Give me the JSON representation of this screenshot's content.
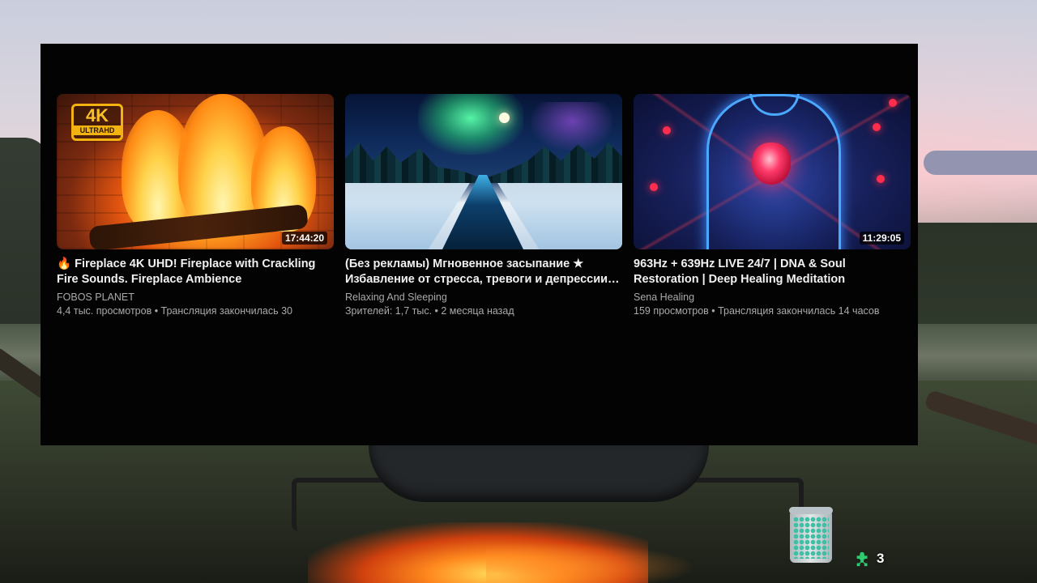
{
  "videos": [
    {
      "title": "🔥 Fireplace 4K UHD! Fireplace with Crackling Fire Sounds. Fireplace Ambience",
      "channel": "FOBOS PLANET",
      "meta": "4,4 тыс. просмотров • Трансляция закончилась 30",
      "duration": "17:44:20",
      "badge_big": "4K",
      "badge_small": "ULTRAHD"
    },
    {
      "title": "(Без рекламы) Мгновенное засыпание ★ Избавление от стресса, тревоги и депрессии…",
      "channel": "Relaxing And Sleeping",
      "meta": "Зрителей: 1,7 тыс. • 2 месяца назад"
    },
    {
      "title": "963Hz + 639Hz LIVE 24/7 | DNA & Soul Restoration | Deep Healing Meditation",
      "channel": "Sena Healing",
      "meta": "159 просмотров • Трансляция закончилась 14 часов",
      "duration": "11:29:05"
    }
  ],
  "overlay": {
    "counter_value": "3",
    "counter_icon": "puzzle-icon",
    "jar_icon": "jar-icon"
  },
  "colors": {
    "panel_bg": "#030303",
    "title_text": "#f1f1f1",
    "secondary_text": "#aaaaaa",
    "badge_gold": "#f2b311",
    "counter_green": "#2ecc71"
  }
}
